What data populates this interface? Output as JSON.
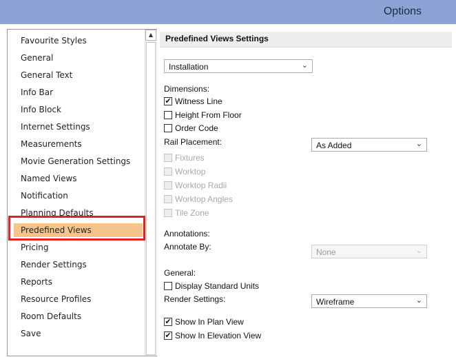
{
  "window": {
    "title": "Options"
  },
  "sidebar": {
    "items": [
      {
        "label": "Favourite Styles"
      },
      {
        "label": "General"
      },
      {
        "label": "General Text"
      },
      {
        "label": "Info Bar"
      },
      {
        "label": "Info Block"
      },
      {
        "label": "Internet Settings"
      },
      {
        "label": "Measurements"
      },
      {
        "label": "Movie Generation Settings"
      },
      {
        "label": "Named Views"
      },
      {
        "label": "Notification"
      },
      {
        "label": "Planning Defaults"
      },
      {
        "label": "Predefined Views",
        "selected": true
      },
      {
        "label": "Pricing"
      },
      {
        "label": "Render Settings"
      },
      {
        "label": "Reports"
      },
      {
        "label": "Resource Profiles"
      },
      {
        "label": "Room Defaults"
      },
      {
        "label": "Save"
      }
    ],
    "scroll_up_icon": "up-arrow-icon"
  },
  "main": {
    "header": "Predefined Views Settings",
    "view_select": {
      "value": "Installation"
    },
    "dimensions": {
      "label": "Dimensions:",
      "witness_line": {
        "label": "Witness Line",
        "checked": true
      },
      "height_from_floor": {
        "label": "Height From Floor",
        "checked": false
      },
      "order_code": {
        "label": "Order Code",
        "checked": false
      }
    },
    "rail_placement": {
      "label": "Rail Placement:",
      "value": "As Added"
    },
    "disabled_items": {
      "fixtures": "Fixtures",
      "worktop": "Worktop",
      "worktop_radii": "Worktop Radii",
      "worktop_angles": "Worktop Angles",
      "tile_zone": "Tile Zone"
    },
    "annotations": {
      "label": "Annotations:",
      "annotate_by": {
        "label": "Annotate By:",
        "value": "None",
        "disabled": true
      }
    },
    "general": {
      "label": "General:",
      "display_standard_units": {
        "label": "Display Standard Units",
        "checked": false
      },
      "render_settings": {
        "label": "Render Settings:",
        "value": "Wireframe"
      },
      "show_in_plan_view": {
        "label": "Show In Plan View",
        "checked": true
      },
      "show_in_elevation_view": {
        "label": "Show In Elevation View",
        "checked": true
      }
    }
  },
  "glyphs": {
    "check": "✔",
    "chevron": "⌄",
    "up": "▲"
  },
  "colors": {
    "titlebar": "#8da3d6",
    "selection": "#f5c58b",
    "highlight_border": "#d9242a"
  }
}
